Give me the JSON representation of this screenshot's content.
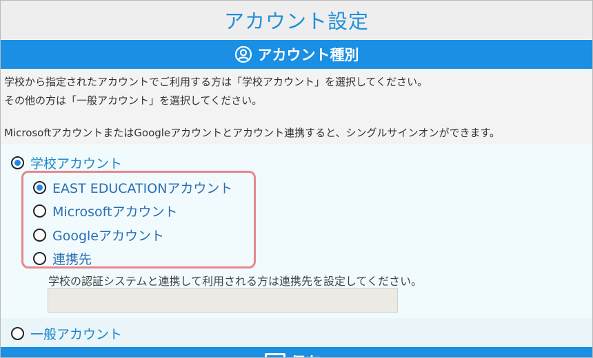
{
  "title": "アカウント設定",
  "section": {
    "icon": "user-circle-icon",
    "title": "アカウント種別"
  },
  "description": {
    "line1": "学校から指定されたアカウントでご利用する方は「学校アカウント」を選択してください。",
    "line2": "その他の方は「一般アカウント」を選択してください。",
    "line3": "MicrosoftアカウントまたはGoogleアカウントとアカウント連携すると、シングルサインオンができます。"
  },
  "account_types": {
    "school": {
      "label": "学校アカウント",
      "checked": true
    },
    "general": {
      "label": "一般アカウント",
      "checked": false
    }
  },
  "school_options": [
    {
      "label": "EAST EDUCATIONアカウント",
      "checked": true
    },
    {
      "label": "Microsoftアカウント",
      "checked": false
    },
    {
      "label": "Googleアカウント",
      "checked": false
    },
    {
      "label": "連携先",
      "checked": false
    }
  ],
  "link_hint": "学校の認証システムと連携して利用される方は連携先を設定してください。",
  "link_input": {
    "value": "",
    "placeholder": ""
  },
  "bottom": {
    "label": "保存",
    "icon": "save-icon"
  },
  "colors": {
    "accent": "#1a8fe3",
    "title_text": "#1f8fd8",
    "highlight": "#e7868d",
    "radio_dot": "#1e88e5"
  }
}
